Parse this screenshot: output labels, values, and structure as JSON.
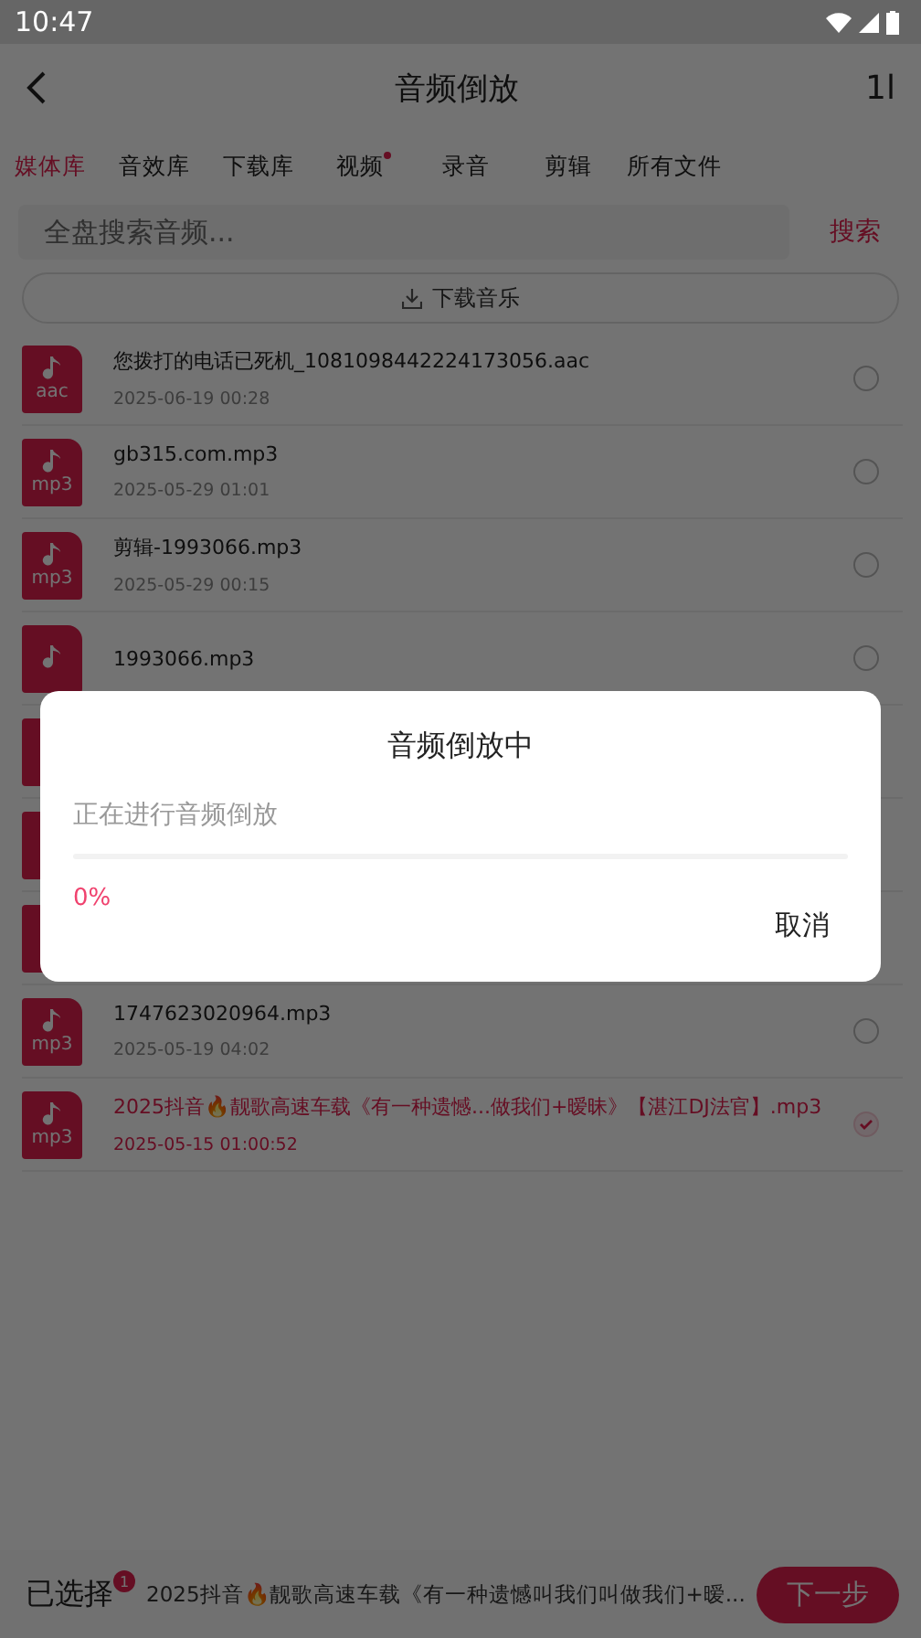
{
  "status_bar": {
    "time": "10:47"
  },
  "header": {
    "title": "音频倒放",
    "sort_label": "1l"
  },
  "tabs": [
    {
      "label": "媒体库",
      "selected": true,
      "dot": false
    },
    {
      "label": "音效库",
      "selected": false,
      "dot": false
    },
    {
      "label": "下载库",
      "selected": false,
      "dot": false
    },
    {
      "label": "视频",
      "selected": false,
      "dot": true
    },
    {
      "label": "录音",
      "selected": false,
      "dot": false
    },
    {
      "label": "剪辑",
      "selected": false,
      "dot": false
    },
    {
      "label": "所有文件",
      "selected": false,
      "dot": false
    }
  ],
  "search": {
    "placeholder": "全盘搜索音频...",
    "button": "搜索"
  },
  "download_button": "下载音乐",
  "files": [
    {
      "kind": "file",
      "ext": "aac",
      "name": "您拨打的电话已死机_1081098442224173056.aac",
      "date": "2025-06-19  00:28",
      "checked": false
    },
    {
      "kind": "file",
      "ext": "mp3",
      "name": "gb315.com.mp3",
      "date": "2025-05-29  01:01",
      "checked": false
    },
    {
      "kind": "file",
      "ext": "mp3",
      "name": "剪辑-1993066.mp3",
      "date": "2025-05-29  00:15",
      "checked": false
    },
    {
      "kind": "file",
      "name": "1993066.mp3",
      "checked": false
    },
    {
      "kind": "covered"
    },
    {
      "kind": "covered"
    },
    {
      "kind": "covered"
    },
    {
      "kind": "file",
      "ext": "mp3",
      "name": "1747623020964.mp3",
      "date": "2025-05-19  04:02",
      "checked": false
    },
    {
      "kind": "file",
      "ext": "mp3",
      "name": "2025抖音🔥靓歌高速车载《有一种遗憾...做我们+暧昧》【湛江DJ法官】.mp3",
      "date": "2025-05-15  01:00:52",
      "checked": true
    }
  ],
  "bottom_bar": {
    "label": "已选择",
    "count": "1",
    "selection": "2025抖音🔥靓歌高速车载《有一种遗憾叫我们叫做我们+暧...",
    "next": "下一步"
  },
  "dialog": {
    "title": "音频倒放中",
    "message": "正在进行音频倒放",
    "progress": {
      "level": 0
    },
    "percent": "0%",
    "cancel": "取消"
  }
}
